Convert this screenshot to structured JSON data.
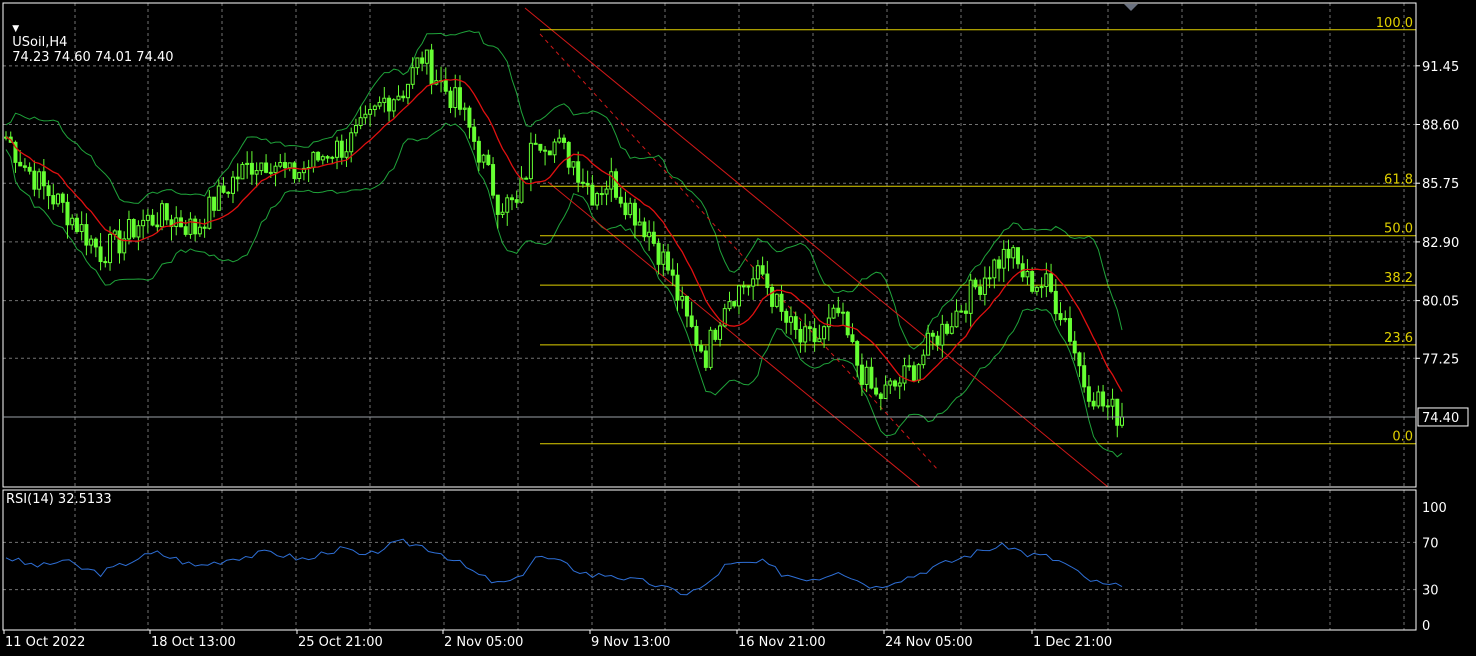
{
  "header": {
    "symbol": "USoil,H4",
    "ohlc": "74.23 74.60 74.01 74.40"
  },
  "rsi_header": "RSI(14) 32.5133",
  "price_tag": "74.40",
  "colors": {
    "background": "#000000",
    "grid": "#d0d0d0",
    "candle": "#66ff33",
    "moving_average": "#e01010",
    "bollinger": "#1fa33a",
    "fibonacci": "#e0d000",
    "channel": "#d01818",
    "rsi_line": "#2e6fd6",
    "axis_text": "#ffffff"
  },
  "chart_data": [
    {
      "type": "line",
      "title": "USoil,H4",
      "description_items": [
        "candlestick price",
        "20-period moving average",
        "Bollinger bands",
        "Fibonacci retracement",
        "descending channel"
      ],
      "x": [
        "11 Oct 2022",
        "18 Oct 13:00",
        "25 Oct 21:00",
        "2 Nov 05:00",
        "9 Nov 13:00",
        "16 Nov 21:00",
        "24 Nov 05:00",
        "1 Dec 21:00"
      ],
      "y_ticks": [
        "91.45",
        "88.60",
        "85.75",
        "82.90",
        "80.05",
        "77.25"
      ],
      "ylim": [
        71.0,
        94.5
      ],
      "grid": true,
      "series": [
        {
          "values": [
            88.0,
            86.6,
            85.5,
            84.6,
            83.5,
            82.4,
            82.9,
            83.8,
            84.1,
            84.0,
            83.5,
            84.8,
            85.9,
            86.7,
            86.9,
            86.1,
            86.6,
            87.3,
            87.6,
            88.5,
            89.8,
            90.3,
            91.9,
            90.6,
            89.4,
            87.3,
            84.9,
            84.6,
            88.1,
            87.7,
            86.8,
            85.3,
            85.9,
            84.6,
            83.4,
            81.6,
            79.0,
            77.4,
            80.1,
            80.8,
            81.3,
            79.3,
            78.1,
            78.2,
            79.4,
            77.0,
            75.3,
            75.9,
            76.8,
            78.1,
            79.2,
            80.4,
            81.6,
            82.4,
            81.0,
            80.8,
            79.2,
            76.1,
            75.0,
            74.4
          ]
        },
        {
          "name": "Fibonacci levels",
          "levels": [
            {
              "label": "100.0",
              "price": 93.2
            },
            {
              "label": "61.8",
              "price": 85.6
            },
            {
              "label": "50.0",
              "price": 83.2
            },
            {
              "label": "38.2",
              "price": 80.8
            },
            {
              "label": "23.6",
              "price": 77.9
            },
            {
              "label": "0.0",
              "price": 73.1
            }
          ]
        }
      ],
      "current_price": 74.4
    },
    {
      "type": "line",
      "title": "RSI(14) 32.5133",
      "y_ticks": [
        "100",
        "70",
        "30",
        "0"
      ],
      "ylim": [
        0,
        100
      ],
      "grid": true,
      "series": [
        {
          "values": [
            58,
            52,
            50,
            55,
            48,
            44,
            50,
            57,
            61,
            56,
            50,
            53,
            57,
            59,
            62,
            58,
            55,
            63,
            64,
            57,
            66,
            70,
            67,
            61,
            52,
            42,
            35,
            38,
            58,
            55,
            48,
            42,
            43,
            38,
            36,
            30,
            27,
            33,
            50,
            52,
            53,
            44,
            40,
            40,
            47,
            38,
            32,
            38,
            42,
            49,
            54,
            60,
            65,
            67,
            60,
            58,
            52,
            40,
            34,
            32.5
          ]
        }
      ]
    }
  ]
}
